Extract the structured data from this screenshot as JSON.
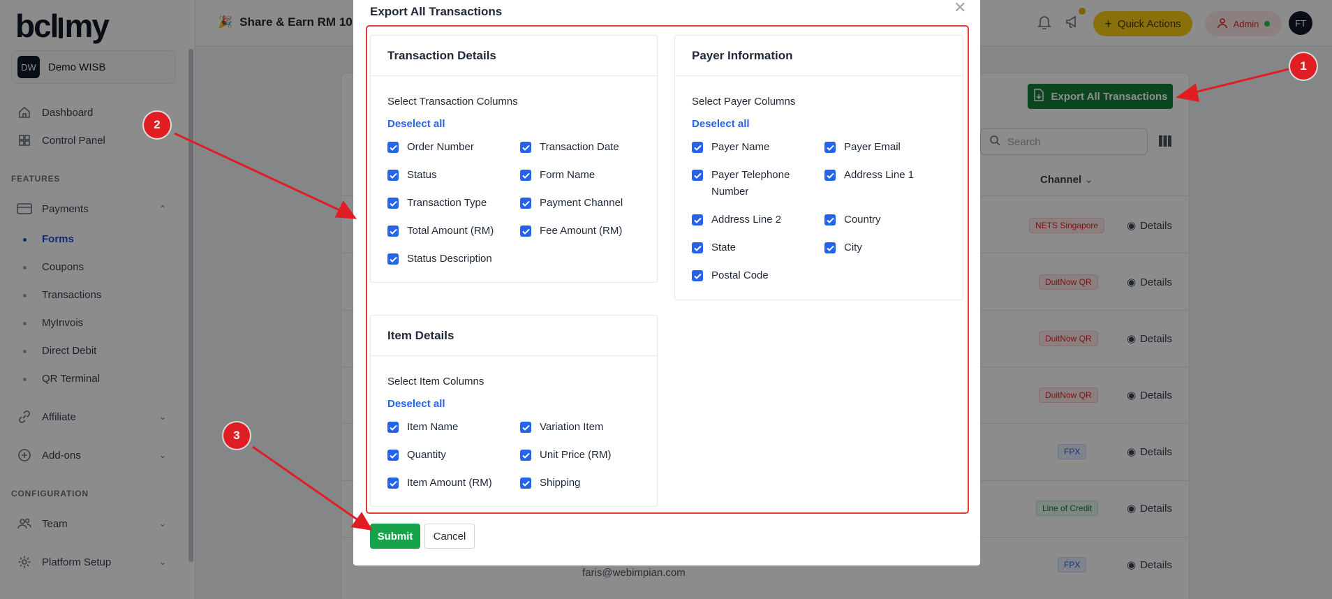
{
  "logo": {
    "text_left": "bcl",
    "text_right": "my"
  },
  "workspace": {
    "initials": "DW",
    "name": "Demo WISB"
  },
  "sidebar": {
    "dashboard": "Dashboard",
    "control_panel": "Control Panel",
    "features_heading": "FEATURES",
    "payments": "Payments",
    "payments_sub": [
      "Forms",
      "Coupons",
      "Transactions",
      "MyInvois",
      "Direct Debit",
      "QR Terminal"
    ],
    "affiliate": "Affiliate",
    "addons": "Add-ons",
    "configuration_heading": "CONFIGURATION",
    "team": "Team",
    "platform_setup": "Platform Setup"
  },
  "topbar": {
    "promo": "Share & Earn RM 10!",
    "quick_actions": "Quick Actions",
    "admin": "Admin",
    "avatar": "FT"
  },
  "background": {
    "export_button": "Export All Transactions",
    "search_placeholder": "Search",
    "channel_header": "Channel",
    "details_label": "Details",
    "channels": [
      "NETS Singapore",
      "DuitNow QR",
      "DuitNow QR",
      "DuitNow QR",
      "FPX",
      "Line of Credit",
      "FPX"
    ],
    "email": "faris@webimpian.com"
  },
  "modal": {
    "title": "Export All Transactions",
    "transaction": {
      "title": "Transaction Details",
      "subtitle": "Select Transaction Columns",
      "deselect": "Deselect all",
      "columns": [
        "Order Number",
        "Transaction Date",
        "Status",
        "Form Name",
        "Transaction Type",
        "Payment Channel",
        "Total Amount (RM)",
        "Fee Amount (RM)",
        "Status Description"
      ]
    },
    "payer": {
      "title": "Payer Information",
      "subtitle": "Select Payer Columns",
      "deselect": "Deselect all",
      "columns": [
        "Payer Name",
        "Payer Email",
        "Payer Telephone Number",
        "Address Line 1",
        "Address Line 2",
        "Country",
        "State",
        "City",
        "Postal Code"
      ]
    },
    "item": {
      "title": "Item Details",
      "subtitle": "Select Item Columns",
      "deselect": "Deselect all",
      "columns": [
        "Item Name",
        "Variation Item",
        "Quantity",
        "Unit Price (RM)",
        "Item Amount (RM)",
        "Shipping"
      ]
    },
    "submit": "Submit",
    "cancel": "Cancel"
  },
  "annotations": [
    "1",
    "2",
    "3"
  ],
  "colors": {
    "accent_blue": "#2563eb",
    "export_green": "#15803d",
    "submit_green": "#16a34a",
    "callout_red": "#e11d24",
    "quick_actions_yellow": "#facc15"
  }
}
